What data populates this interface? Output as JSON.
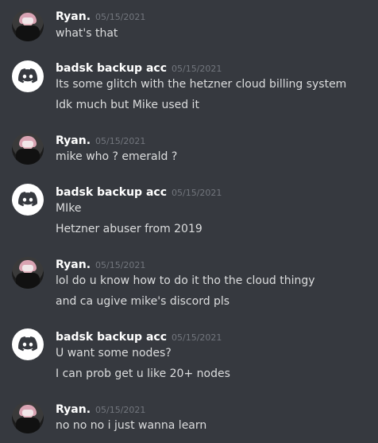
{
  "messages": [
    {
      "author": "Ryan.",
      "avatar": "anime-avatar",
      "timestamp": "05/15/2021",
      "lines": [
        "what's that"
      ]
    },
    {
      "author": "badsk backup acc",
      "avatar": "discord-default-avatar",
      "timestamp": "05/15/2021",
      "lines": [
        "Its some glitch with the hetzner cloud billing system",
        "Idk much but Mike used it"
      ]
    },
    {
      "author": "Ryan.",
      "avatar": "anime-avatar",
      "timestamp": "05/15/2021",
      "lines": [
        "mike who ? emerald ?"
      ]
    },
    {
      "author": "badsk backup acc",
      "avatar": "discord-default-avatar",
      "timestamp": "05/15/2021",
      "lines": [
        "MIke",
        "Hetzner abuser from 2019"
      ]
    },
    {
      "author": "Ryan.",
      "avatar": "anime-avatar",
      "timestamp": "05/15/2021",
      "lines": [
        "lol do u know how to do it tho the cloud thingy",
        "and ca  ugive mike's discord pls"
      ]
    },
    {
      "author": "badsk backup acc",
      "avatar": "discord-default-avatar",
      "timestamp": "05/15/2021",
      "lines": [
        "U want some nodes?",
        "I can prob get u like 20+ nodes"
      ]
    },
    {
      "author": "Ryan.",
      "avatar": "anime-avatar",
      "timestamp": "05/15/2021",
      "lines": [
        "no no no i just wanna learn"
      ]
    }
  ],
  "colors": {
    "background": "#36393f",
    "username": "#ffffff",
    "timestamp": "#72767d",
    "text": "#dcddde"
  }
}
